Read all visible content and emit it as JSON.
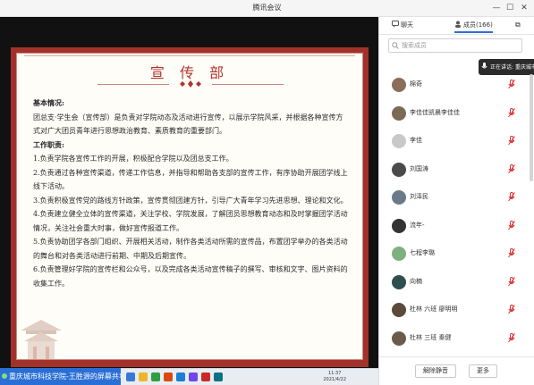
{
  "window": {
    "title": "腾讯会议"
  },
  "slide": {
    "title": "宣 传 部",
    "basic_heading": "基本情况:",
    "basic_text": "团总支·学生会（宣传部）是负责对学院动态及活动进行宣传，以展示学院风采，并根据各种宣传方式对广大团员青年进行思想政治教育、素质教育的重要部门。",
    "duty_heading": "工作职责:",
    "duties": [
      "1.负责学院各宣传工作的开展，积极配合学院以及团总支工作。",
      "2.负责通过各种宣传渠道，传递工作信息，并指导和帮助各支部的宣传工作，有序协助开展团学线上线下活动。",
      "3.负责积极宣传党的路线方针政策，宣传贯彻团建方针，引导广大青年学习先进思想、理论和文化。",
      "4.负责建立健全立体的宣传渠道，关注学校、学院发展，了解团员思想教育动态和及时掌握团学活动情况，关注社会重大时事，做好宣传报道工作。",
      "5.负责协助团学各部门组织、开展相关活动，制作各类活动所需的宣传品，布置团学举办的各类活动的舞台和对各类活动进行前期、中期及后期宣传。",
      "6.负责管理好学院的宣传栏和公众号，以及完成各类活动宣传稿子的撰写、审核和文字、图片资料的收集工作。"
    ]
  },
  "share_banner": {
    "text": "重庆城市科技学院-王胜源的屏幕共享"
  },
  "taskbar": {
    "time": "11:37",
    "date": "2021/4/22"
  },
  "panel": {
    "tab_chat": "聊天",
    "tab_members": "成员(166)",
    "search_placeholder": "搜索成员",
    "speaking_text": "正在讲话: 重庆城市",
    "members": [
      {
        "name": "棉奇",
        "color": "#8a6d5a"
      },
      {
        "name": "李佳佳凯晨李佳佳",
        "color": "#7a6a55"
      },
      {
        "name": "李佳",
        "color": "#c9c9c9"
      },
      {
        "name": "刘国涛",
        "color": "#4a4a4a"
      },
      {
        "name": "刘泽民",
        "color": "#6a7a8a"
      },
      {
        "name": "流年-",
        "color": "#333333"
      },
      {
        "name": "七程李璐",
        "color": "#7fb07f"
      },
      {
        "name": "向楠",
        "color": "#2f4f4f"
      },
      {
        "name": "杜林 六班 廖明明",
        "color": "#5a4a3a"
      },
      {
        "name": "杜林 三班 秦健",
        "color": "#6b5b4b"
      }
    ],
    "btn_mute_all": "解除静音",
    "btn_more": "更多"
  }
}
